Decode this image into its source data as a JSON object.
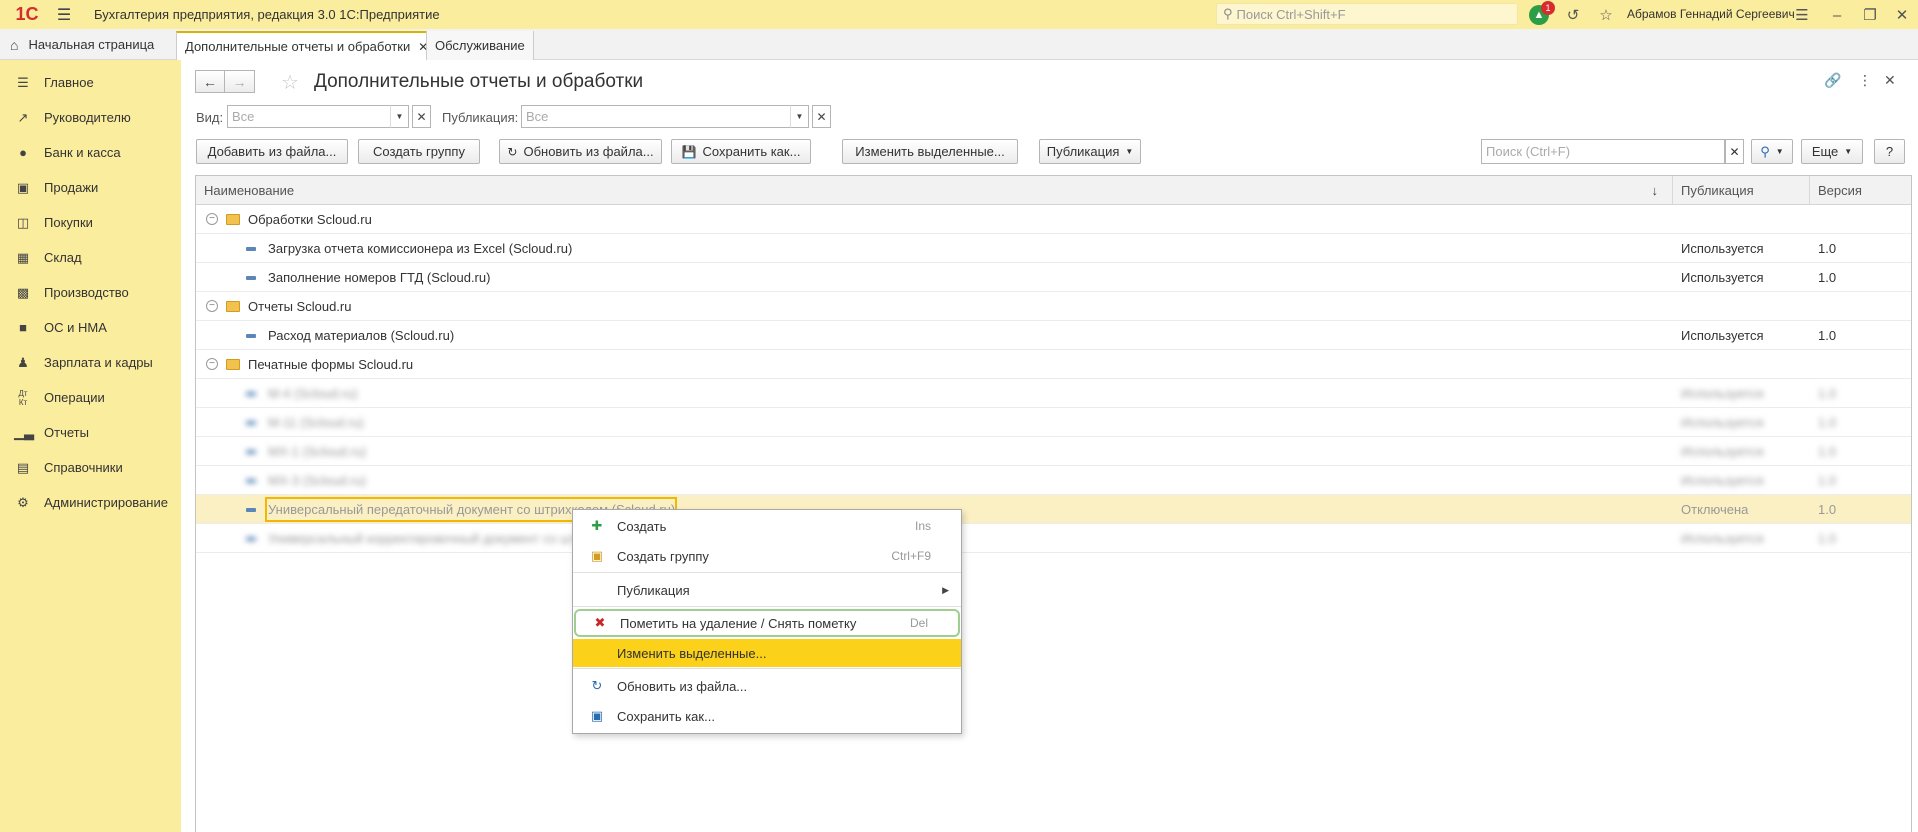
{
  "titlebar": {
    "logo": "1С",
    "title": "Бухгалтерия предприятия, редакция 3.0 1С:Предприятие",
    "search_placeholder": "Поиск Ctrl+Shift+F",
    "notification_count": "1",
    "user": "Абрамов Геннадий Сергеевич"
  },
  "tabs": {
    "home": "Начальная страница",
    "items": [
      {
        "label": "Дополнительные отчеты и обработки"
      },
      {
        "label": "Обслуживание"
      }
    ]
  },
  "sidebar": {
    "items": [
      {
        "label": "Главное",
        "icon": "menu-icon"
      },
      {
        "label": "Руководителю",
        "icon": "trend-icon"
      },
      {
        "label": "Банк и касса",
        "icon": "ruble-icon"
      },
      {
        "label": "Продажи",
        "icon": "bag-icon"
      },
      {
        "label": "Покупки",
        "icon": "cart-icon"
      },
      {
        "label": "Склад",
        "icon": "grid-icon"
      },
      {
        "label": "Производство",
        "icon": "factory-icon"
      },
      {
        "label": "ОС и НМА",
        "icon": "truck-icon"
      },
      {
        "label": "Зарплата и кадры",
        "icon": "person-icon"
      },
      {
        "label": "Операции",
        "icon": "dt-kt-icon"
      },
      {
        "label": "Отчеты",
        "icon": "bar-chart-icon"
      },
      {
        "label": "Справочники",
        "icon": "books-icon"
      },
      {
        "label": "Администрирование",
        "icon": "gear-icon"
      }
    ]
  },
  "form": {
    "title": "Дополнительные отчеты и обработки",
    "filters": {
      "view_label": "Вид:",
      "view_placeholder": "Все",
      "publication_label": "Публикация:",
      "publication_placeholder": "Все"
    },
    "commands": {
      "add_from_file": "Добавить из файла...",
      "create_group": "Создать группу",
      "update_from_file": "Обновить из файла...",
      "save_as": "Сохранить как...",
      "change_selected": "Изменить выделенные...",
      "publication": "Публикация",
      "search_placeholder": "Поиск (Ctrl+F)",
      "more": "Еще",
      "help": "?"
    },
    "table": {
      "columns": [
        "Наименование",
        "Публикация",
        "Версия"
      ],
      "sort_indicator": "↓",
      "rows": [
        {
          "type": "group",
          "name": "Обработки Scloud.ru",
          "publication": "",
          "version": ""
        },
        {
          "type": "item",
          "name": "Загрузка отчета комиссионера из Excel (Scloud.ru)",
          "publication": "Используется",
          "version": "1.0"
        },
        {
          "type": "item",
          "name": "Заполнение номеров ГТД (Scloud.ru)",
          "publication": "Используется",
          "version": "1.0"
        },
        {
          "type": "group",
          "name": "Отчеты Scloud.ru",
          "publication": "",
          "version": ""
        },
        {
          "type": "item",
          "name": "Расход материалов (Scloud.ru)",
          "publication": "Используется",
          "version": "1.0"
        },
        {
          "type": "group",
          "name": "Печатные формы Scloud.ru",
          "publication": "",
          "version": ""
        },
        {
          "type": "blurred",
          "name": "М-4 (Scloud.ru)",
          "publication": "Используется",
          "version": "1.0"
        },
        {
          "type": "blurred",
          "name": "М-11 (Scloud.ru)",
          "publication": "Используется",
          "version": "1.0"
        },
        {
          "type": "blurred",
          "name": "МХ-1 (Scloud.ru)",
          "publication": "Используется",
          "version": "1.0"
        },
        {
          "type": "blurred",
          "name": "МХ-3 (Scloud.ru)",
          "publication": "Используется",
          "version": "1.0"
        },
        {
          "type": "selected",
          "name": "Универсальный передаточный документ со штрихкодом (Scloud.ru)",
          "publication": "Отключена",
          "version": "1.0"
        },
        {
          "type": "blurred",
          "name": "Универсальный корректировочный документ со штрихкодом (Scloud.ru)",
          "publication": "Используется",
          "version": "1.0"
        }
      ]
    }
  },
  "context_menu": {
    "create": "Создать",
    "create_shortcut": "Ins",
    "create_group": "Создать группу",
    "create_group_shortcut": "Ctrl+F9",
    "publication": "Публикация",
    "mark_delete": "Пометить на удаление / Снять пометку",
    "mark_delete_shortcut": "Del",
    "change_selected": "Изменить выделенные...",
    "update_from_file": "Обновить из файла...",
    "save_as": "Сохранить как..."
  }
}
